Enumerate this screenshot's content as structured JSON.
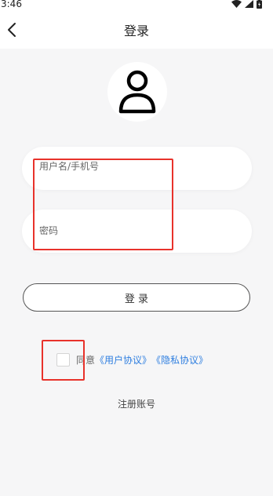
{
  "status_bar": {
    "time": "3:46",
    "icons": [
      "wifi-icon",
      "signal-icon",
      "battery-icon"
    ]
  },
  "header": {
    "title": "登录",
    "back_icon": "chevron-left-icon"
  },
  "avatar": {
    "icon": "user-icon"
  },
  "form": {
    "username_placeholder": "用户名/手机号",
    "username_value": "",
    "password_placeholder": "密码",
    "password_value": ""
  },
  "login_button": {
    "label": "登 录"
  },
  "agreement": {
    "checked": false,
    "prefix": "同意",
    "user_agreement": "《用户协议》",
    "privacy_policy": "《隐私协议》"
  },
  "register": {
    "label": "注册账号"
  },
  "colors": {
    "background": "#f6f6f7",
    "link": "#2f7fe0",
    "highlight": "#e8322b"
  }
}
